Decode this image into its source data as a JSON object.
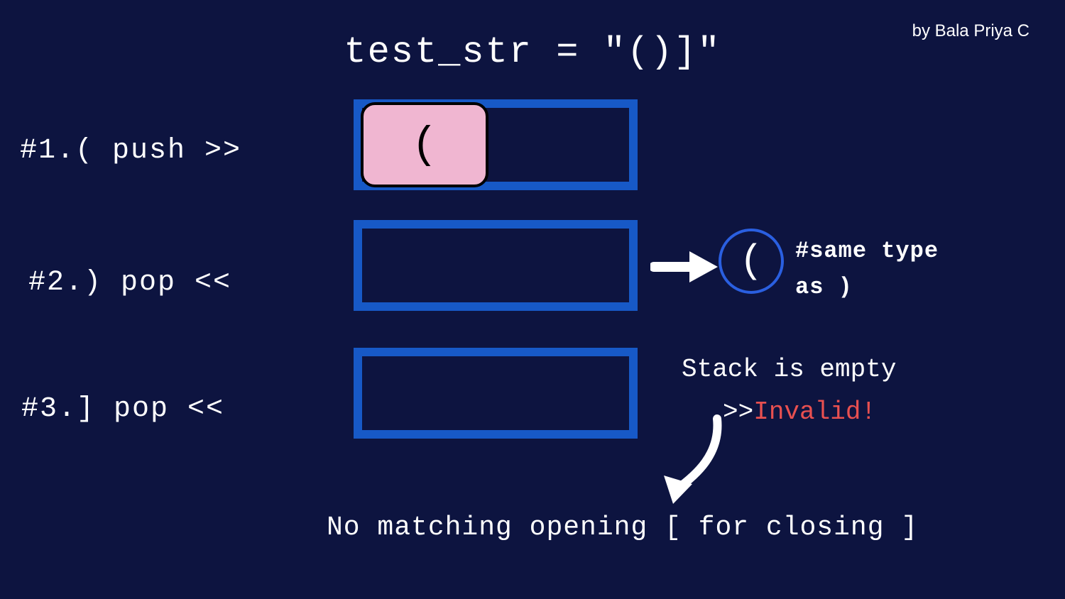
{
  "title": "test_str = \"()]\"",
  "byline": "by Bala Priya C",
  "steps": {
    "s1": {
      "label": "#1.( push >>",
      "tile_char": "("
    },
    "s2": {
      "label": "#2.) pop <<"
    },
    "s3": {
      "label": "#3.] pop <<"
    }
  },
  "popped_char": "(",
  "note_same_type_line1": "#same type",
  "note_same_type_line2": "as )",
  "note_stack_empty": "Stack is empty",
  "note_invalid_prefix": ">>",
  "note_invalid": "Invalid!",
  "bottom_note": "No matching opening [ for closing ]"
}
